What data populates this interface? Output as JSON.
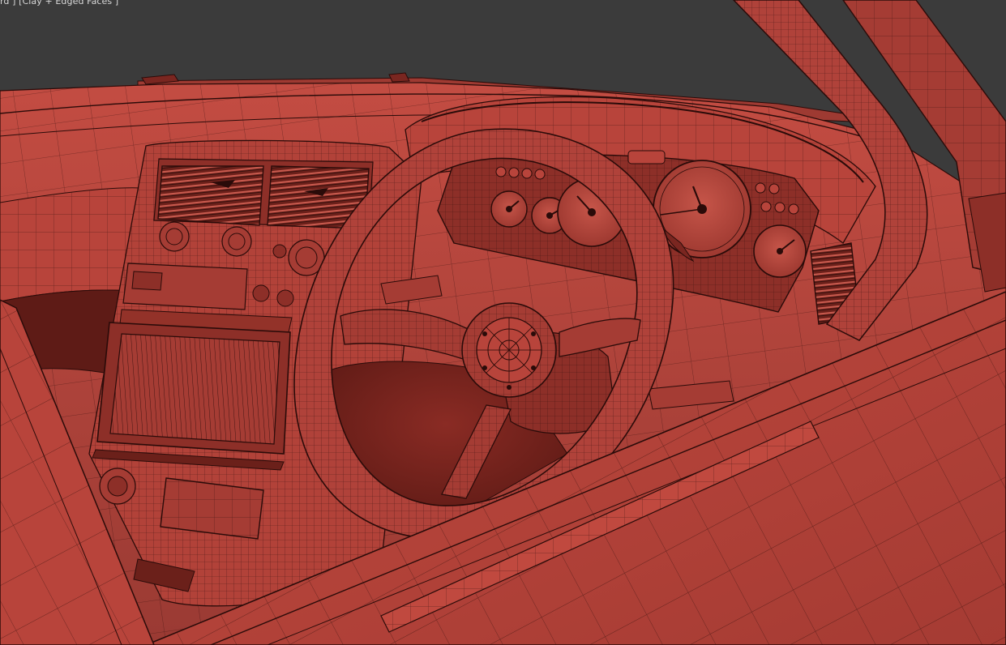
{
  "viewport": {
    "label": "rd ] [Clay + Edged Faces ]",
    "background_color": "#3b3b3b",
    "shading_mode": "Clay + Edged Faces"
  },
  "scene": {
    "clay_color": "#b3453c",
    "clay_dark_color": "#5a1a16",
    "wire_color": "#2a0b09",
    "objects": [
      "dashboard",
      "steering-wheel",
      "instrument-cluster",
      "center-console",
      "air-vents",
      "a-pillar",
      "door-panel"
    ]
  }
}
